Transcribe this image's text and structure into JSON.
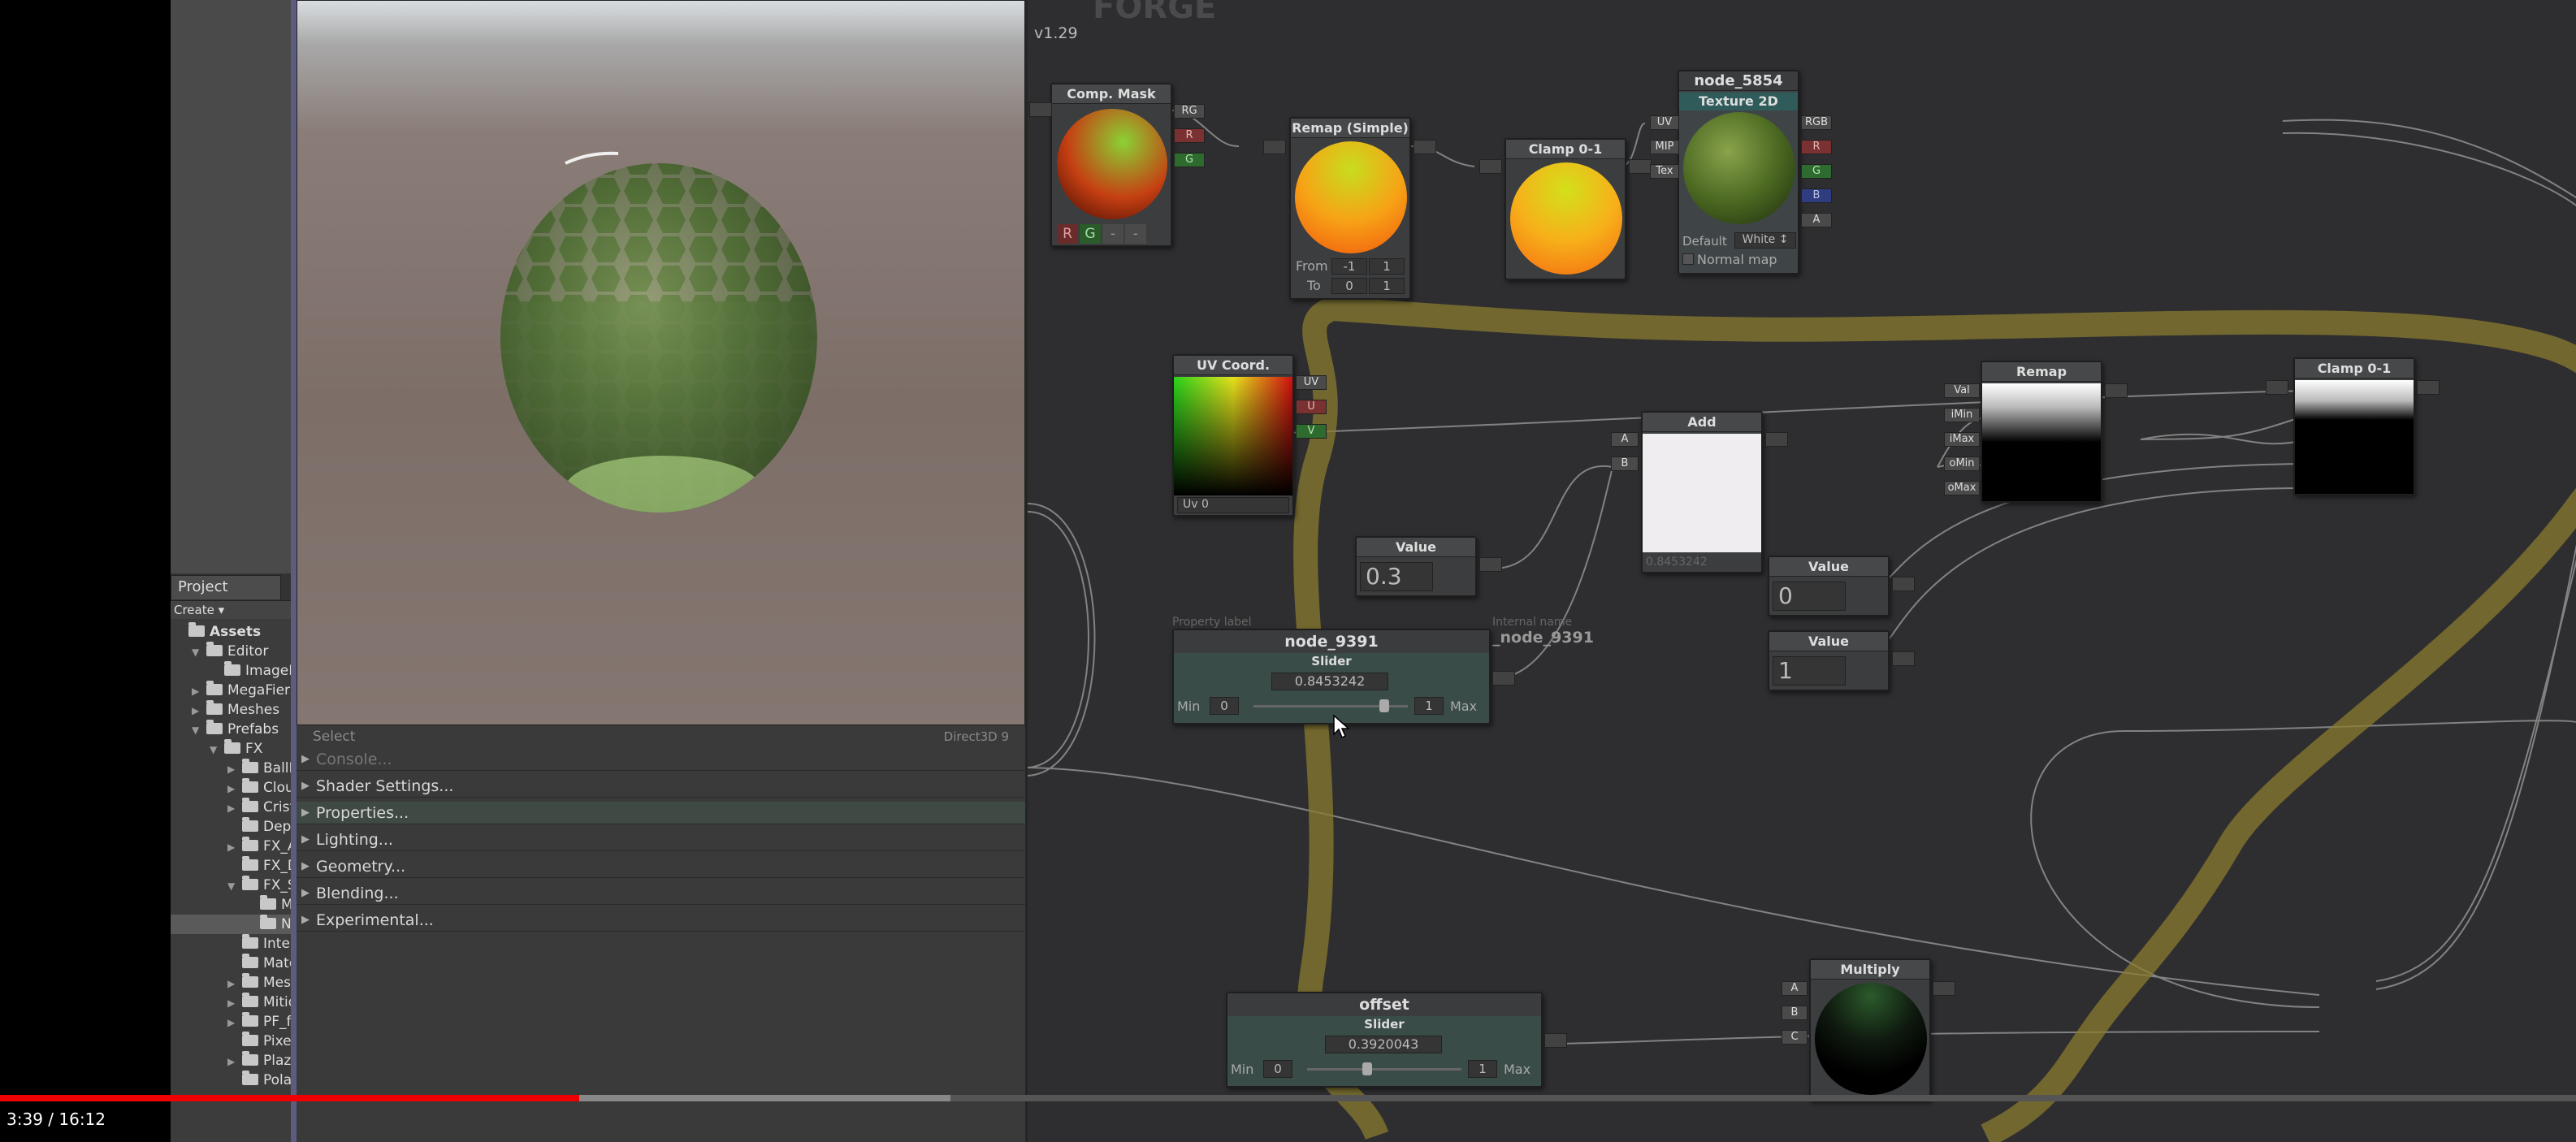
{
  "video": {
    "time": "3:39 / 16:12",
    "played_fraction": 0.225,
    "buffered_fraction": 0.369
  },
  "project": {
    "tab": "Project",
    "create": "Create ▾",
    "items": [
      {
        "label": "Assets",
        "indent": 0,
        "arrow": "",
        "bold": true
      },
      {
        "label": "Editor",
        "indent": 1,
        "arrow": "▼"
      },
      {
        "label": "ImageEf",
        "indent": 2,
        "arrow": ""
      },
      {
        "label": "MegaFiers",
        "indent": 1,
        "arrow": "▶"
      },
      {
        "label": "Meshes",
        "indent": 1,
        "arrow": "▶"
      },
      {
        "label": "Prefabs",
        "indent": 1,
        "arrow": "▼"
      },
      {
        "label": "FX",
        "indent": 2,
        "arrow": "▼"
      },
      {
        "label": "BallEu",
        "indent": 3,
        "arrow": "▶"
      },
      {
        "label": "Cloud",
        "indent": 3,
        "arrow": "▶"
      },
      {
        "label": "Crista",
        "indent": 3,
        "arrow": "▶"
      },
      {
        "label": "Depth",
        "indent": 3,
        "arrow": ""
      },
      {
        "label": "FX_Ar",
        "indent": 3,
        "arrow": "▶"
      },
      {
        "label": "FX_De",
        "indent": 3,
        "arrow": ""
      },
      {
        "label": "FX_SI",
        "indent": 3,
        "arrow": "▼"
      },
      {
        "label": "Mat",
        "indent": 4,
        "arrow": ""
      },
      {
        "label": "New",
        "indent": 4,
        "arrow": "",
        "selected": true
      },
      {
        "label": "Interf",
        "indent": 3,
        "arrow": ""
      },
      {
        "label": "Mater",
        "indent": 3,
        "arrow": ""
      },
      {
        "label": "Mesh",
        "indent": 3,
        "arrow": "▶"
      },
      {
        "label": "Mitiqu",
        "indent": 3,
        "arrow": "▶"
      },
      {
        "label": "PF_fo",
        "indent": 3,
        "arrow": "▶"
      },
      {
        "label": "PixelO",
        "indent": 3,
        "arrow": ""
      },
      {
        "label": "Plazm",
        "indent": 3,
        "arrow": "▶"
      },
      {
        "label": "Polar",
        "indent": 3,
        "arrow": ""
      }
    ]
  },
  "preview_bar": {
    "left": "Select",
    "right": "Direct3D 9"
  },
  "inspector": {
    "sections": [
      {
        "label": "Console...",
        "dim": true
      },
      {
        "label": "Shader Settings..."
      },
      {
        "label": "Properties...",
        "highlight": true
      },
      {
        "label": "Lighting..."
      },
      {
        "label": "Geometry..."
      },
      {
        "label": "Blending..."
      },
      {
        "label": "Experimental..."
      }
    ]
  },
  "canvas": {
    "version": "v1.29",
    "logo": "FORGE",
    "comp_mask": {
      "title": "Comp. Mask",
      "ports": [
        "RG",
        "R",
        "G"
      ],
      "buttons": [
        "R",
        "G",
        "-",
        "-"
      ]
    },
    "remap_simple": {
      "title": "Remap (Simple)",
      "from_label": "From",
      "to_label": "To",
      "from_vals": [
        "-1",
        "1"
      ],
      "to_vals": [
        "0",
        "1"
      ]
    },
    "clamp_top": {
      "title": "Clamp 0-1"
    },
    "texture": {
      "name": "node_5854",
      "title": "Texture 2D",
      "inputs": [
        "UV",
        "MIP",
        "Tex"
      ],
      "outputs": [
        "RGB",
        "R",
        "G",
        "B",
        "A"
      ],
      "default_label": "Default",
      "default_value": "White ↕",
      "normal_map": "Normal map"
    },
    "uv_coord": {
      "title": "UV Coord.",
      "ports": [
        "UV",
        "U",
        "V"
      ],
      "channel": "Uv 0"
    },
    "add": {
      "title": "Add",
      "inputs": [
        "A",
        "B"
      ],
      "value": "0.8453242"
    },
    "remap": {
      "title": "Remap",
      "inputs": [
        "Val",
        "iMin",
        "iMax",
        "oMin",
        "oMax"
      ]
    },
    "clamp_right": {
      "title": "Clamp 0-1"
    },
    "value_a": {
      "title": "Value",
      "value": "0.3"
    },
    "value_b": {
      "title": "Value",
      "value": "0"
    },
    "value_c": {
      "title": "Value",
      "value": "1"
    },
    "slider_main": {
      "property_label": "Property label",
      "internal_label": "Internal name",
      "internal_name": "_node_9391",
      "name": "node_9391",
      "type": "Slider",
      "value": "0.8453242",
      "min_label": "Min",
      "min": "0",
      "max": "1",
      "max_label": "Max",
      "level": 0.845
    },
    "slider_offset": {
      "name": "offset",
      "type": "Slider",
      "value": "0.3920043",
      "min_label": "Min",
      "min": "0",
      "max": "1",
      "max_label": "Max",
      "level": 0.392
    },
    "multiply": {
      "title": "Multiply",
      "inputs": [
        "A",
        "B",
        "C"
      ]
    }
  },
  "colors": {
    "annotation": "#8a7b2e",
    "canvas": "#2e2e30",
    "timeline_played": "#e00000"
  }
}
